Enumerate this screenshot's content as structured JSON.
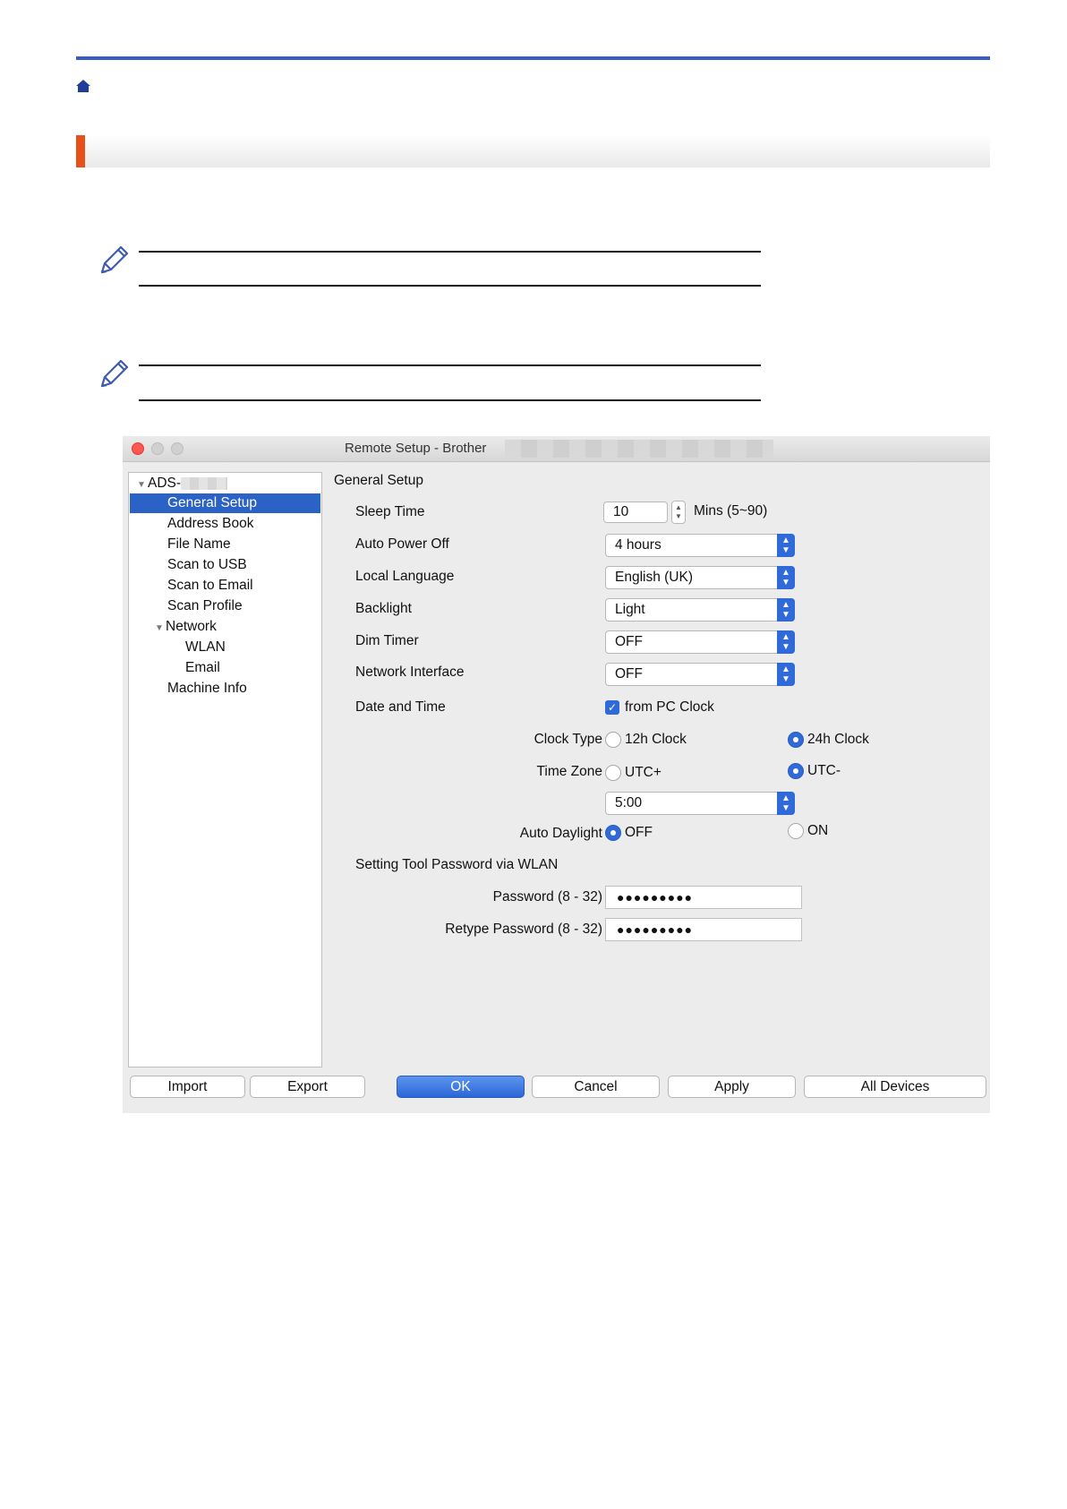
{
  "window": {
    "title": "Remote Setup - Brother"
  },
  "sidebar": {
    "root": "ADS-",
    "items": [
      {
        "label": "General Setup",
        "selected": true
      },
      {
        "label": "Address Book"
      },
      {
        "label": "File Name"
      },
      {
        "label": "Scan to USB"
      },
      {
        "label": "Scan to Email"
      },
      {
        "label": "Scan Profile"
      },
      {
        "label": "Network",
        "expanded": true
      },
      {
        "label": "WLAN"
      },
      {
        "label": "Email"
      },
      {
        "label": "Machine Info"
      }
    ]
  },
  "settings": {
    "section_title": "General Setup",
    "sleep_time": {
      "label": "Sleep Time",
      "value": "10",
      "unit": "Mins (5~90)"
    },
    "auto_power_off": {
      "label": "Auto Power Off",
      "value": "4 hours"
    },
    "local_language": {
      "label": "Local Language",
      "value": "English (UK)"
    },
    "backlight": {
      "label": "Backlight",
      "value": "Light"
    },
    "dim_timer": {
      "label": "Dim Timer",
      "value": "OFF"
    },
    "network_interface": {
      "label": "Network Interface",
      "value": "OFF"
    },
    "date_time": {
      "label": "Date and Time",
      "checkbox_label": "from PC Clock",
      "checked": true
    },
    "clock_type": {
      "label": "Clock Type",
      "option_a": "12h Clock",
      "option_b": "24h Clock",
      "selected": "24h Clock"
    },
    "time_zone": {
      "label": "Time Zone",
      "option_a": "UTC+",
      "option_b": "UTC-",
      "selected": "UTC-",
      "value": "5:00"
    },
    "auto_daylight": {
      "label": "Auto Daylight",
      "option_a": "OFF",
      "option_b": "ON",
      "selected": "OFF"
    },
    "password_section": "Setting Tool Password via WLAN",
    "password": {
      "label": "Password (8 - 32)",
      "value": "●●●●●●●●●"
    },
    "retype_password": {
      "label": "Retype Password (8 - 32)",
      "value": "●●●●●●●●●"
    }
  },
  "buttons": {
    "import": "Import",
    "export": "Export",
    "ok": "OK",
    "cancel": "Cancel",
    "apply": "Apply",
    "all_devices": "All Devices"
  },
  "colors": {
    "top_rule": "#3a5cc6",
    "title_accent": "#e8501a",
    "selection": "#2a62c6",
    "control_accent": "#2f6ad8"
  }
}
